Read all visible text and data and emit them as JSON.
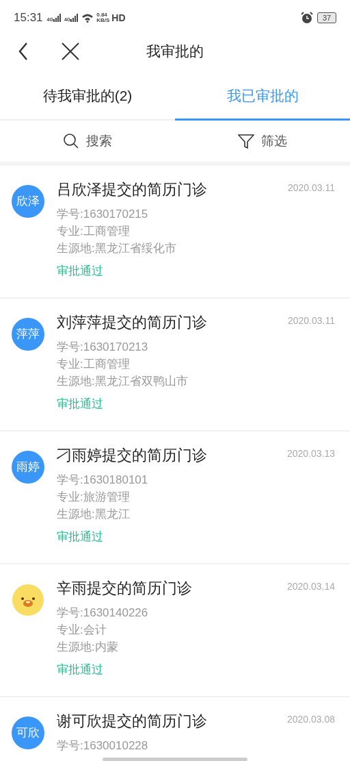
{
  "status_bar": {
    "time": "15:31",
    "network_1": "4G",
    "network_2": "4G",
    "speed_value": "0.84",
    "speed_unit": "KB/S",
    "hd": "HD",
    "battery": "37"
  },
  "nav": {
    "title": "我审批的"
  },
  "tabs": [
    {
      "label": "待我审批的(2)",
      "selected": false
    },
    {
      "label": "我已审批的",
      "selected": true
    }
  ],
  "toolbar": {
    "search": "搜索",
    "filter": "筛选"
  },
  "items": [
    {
      "avatar": {
        "kind": "text",
        "text": "欣泽"
      },
      "title": "吕欣泽提交的简历门诊",
      "date": "2020.03.11",
      "lines": [
        "学号:1630170215",
        "专业:工商管理",
        "生源地:黑龙江省绥化市"
      ],
      "status": "审批通过"
    },
    {
      "avatar": {
        "kind": "text",
        "text": "萍萍"
      },
      "title": "刘萍萍提交的简历门诊",
      "date": "2020.03.11",
      "lines": [
        "学号:1630170213",
        "专业:工商管理",
        "生源地:黑龙江省双鸭山市"
      ],
      "status": "审批通过"
    },
    {
      "avatar": {
        "kind": "text",
        "text": "雨婷"
      },
      "title": "刁雨婷提交的简历门诊",
      "date": "2020.03.13",
      "lines": [
        "学号:1630180101",
        "专业:旅游管理",
        "生源地:黑龙江"
      ],
      "status": "审批通过"
    },
    {
      "avatar": {
        "kind": "emoji"
      },
      "title": "辛雨提交的简历门诊",
      "date": "2020.03.14",
      "lines": [
        "学号:1630140226",
        "专业:会计",
        "生源地:内蒙"
      ],
      "status": "审批通过"
    },
    {
      "avatar": {
        "kind": "text",
        "text": "可欣"
      },
      "title": "谢可欣提交的简历门诊",
      "date": "2020.03.08",
      "lines": [
        "学号:1630010228"
      ]
    }
  ]
}
